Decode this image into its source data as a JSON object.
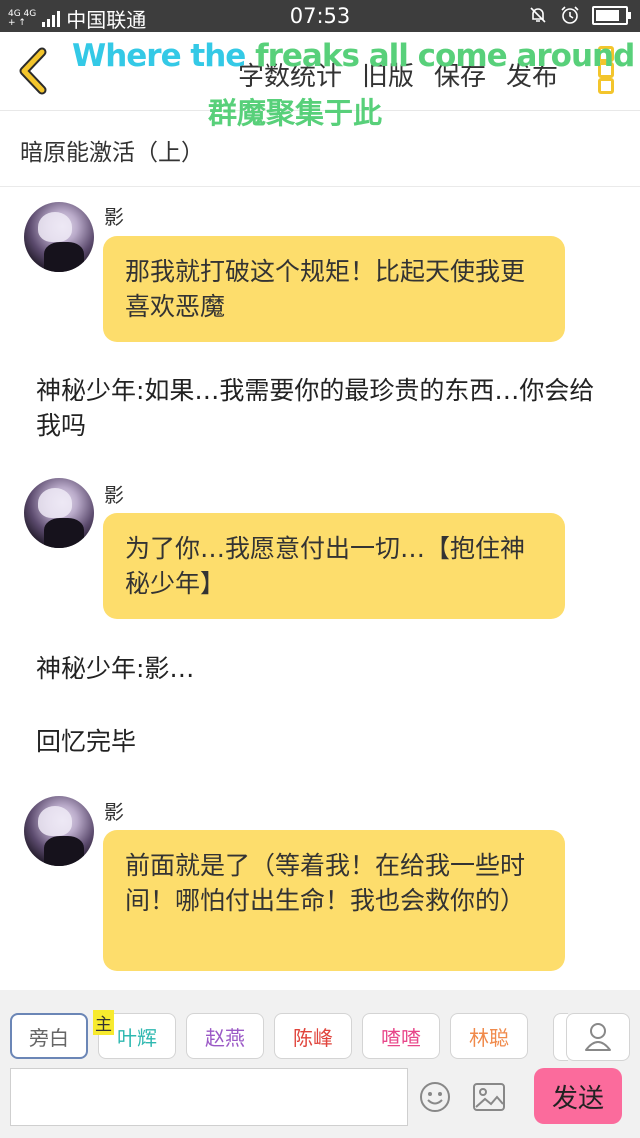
{
  "status_bar": {
    "network_top": "4G 4G",
    "network_bottom": "+ ↑",
    "carrier": "中国联通",
    "time": "07:53"
  },
  "header": {
    "menu": [
      "字数统计",
      "旧版",
      "保存",
      "发布"
    ],
    "overlay_line1_part1": "Where the ",
    "overlay_line1_part2": "freaks all come around",
    "overlay_line2": "群魔聚集于此",
    "accent_color": "#f3c52c"
  },
  "chapter_title": "暗原能激活（上）",
  "messages": [
    {
      "sender": "影",
      "text": "那我就打破这个规矩！比起天使我更喜欢恶魔"
    },
    {
      "narration": "神秘少年:如果…我需要你的最珍贵的东西…你会给我吗"
    },
    {
      "sender": "影",
      "text": "为了你…我愿意付出一切…【抱住神秘少年】"
    },
    {
      "narration": "神秘少年:影…"
    },
    {
      "narration": "回忆完毕"
    },
    {
      "sender": "影",
      "text": "前面就是了（等着我！在给我一些时间！哪怕付出生命！我也会救你的）"
    }
  ],
  "characters": [
    {
      "name": "旁白",
      "color": "#666666",
      "active": true
    },
    {
      "name": "叶辉",
      "color": "#2eb8b0",
      "tag": "主"
    },
    {
      "name": "赵燕",
      "color": "#9b59c6"
    },
    {
      "name": "陈峰",
      "color": "#e0443c"
    },
    {
      "name": "喳喳",
      "color": "#e8478a"
    },
    {
      "name": "林聪",
      "color": "#f08a4b"
    }
  ],
  "composer": {
    "placeholder": "",
    "send_label": "发送",
    "send_color": "#fb6b9c"
  },
  "bubble_color": "#fddd6c"
}
